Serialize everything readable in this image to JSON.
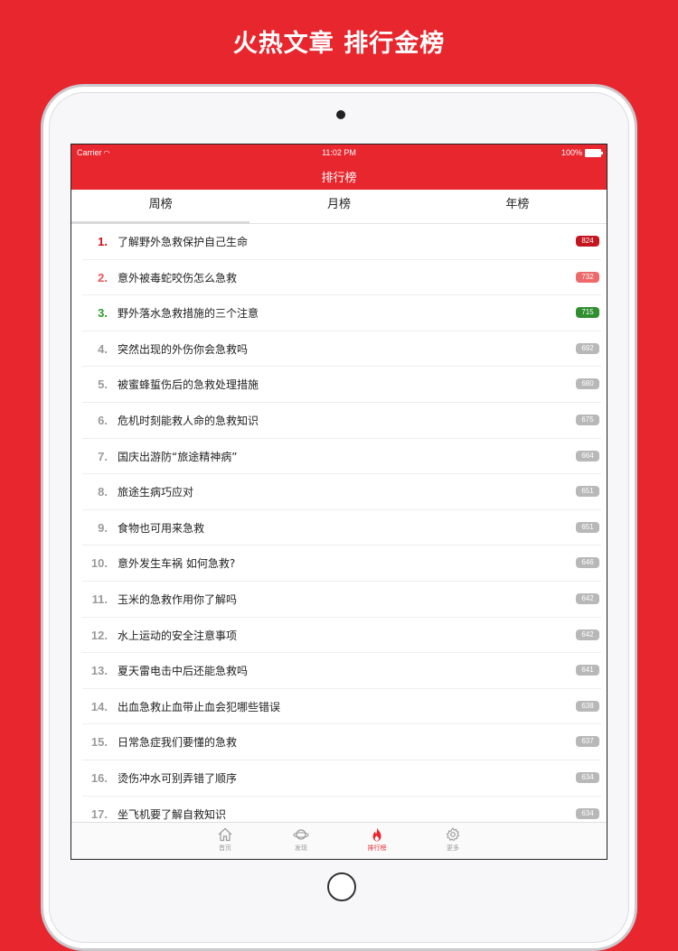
{
  "promo": {
    "title": "火热文章 排行金榜"
  },
  "status_bar": {
    "carrier": "Carrier",
    "time": "11:02 PM",
    "battery": "100%"
  },
  "nav": {
    "title": "排行榜"
  },
  "tabs": [
    {
      "label": "周榜",
      "active": true
    },
    {
      "label": "月榜",
      "active": false
    },
    {
      "label": "年榜",
      "active": false
    }
  ],
  "articles": [
    {
      "rank": "1.",
      "title": "了解野外急救保护自己生命",
      "count": "824"
    },
    {
      "rank": "2.",
      "title": "意外被毒蛇咬伤怎么急救",
      "count": "732"
    },
    {
      "rank": "3.",
      "title": "野外落水急救措施的三个注意",
      "count": "715"
    },
    {
      "rank": "4.",
      "title": "突然出现的外伤你会急救吗",
      "count": "692"
    },
    {
      "rank": "5.",
      "title": "被蜜蜂蜇伤后的急救处理措施",
      "count": "680"
    },
    {
      "rank": "6.",
      "title": "危机时刻能救人命的急救知识",
      "count": "675"
    },
    {
      "rank": "7.",
      "title": "国庆出游防“旅途精神病”",
      "count": "664"
    },
    {
      "rank": "8.",
      "title": "旅途生病巧应对",
      "count": "651"
    },
    {
      "rank": "9.",
      "title": "食物也可用来急救",
      "count": "651"
    },
    {
      "rank": "10.",
      "title": "意外发生车祸 如何急救?",
      "count": "646"
    },
    {
      "rank": "11.",
      "title": "玉米的急救作用你了解吗",
      "count": "642"
    },
    {
      "rank": "12.",
      "title": "水上运动的安全注意事项",
      "count": "642"
    },
    {
      "rank": "13.",
      "title": "夏天雷电击中后还能急救吗",
      "count": "641"
    },
    {
      "rank": "14.",
      "title": "出血急救止血带止血会犯哪些错误",
      "count": "638"
    },
    {
      "rank": "15.",
      "title": "日常急症我们要懂的急救",
      "count": "637"
    },
    {
      "rank": "16.",
      "title": "烫伤冲水可别弄错了顺序",
      "count": "634"
    },
    {
      "rank": "17.",
      "title": "坐飞机要了解自救知识",
      "count": "634"
    }
  ],
  "tabbar": [
    {
      "label": "首页",
      "icon": "home-icon",
      "active": false
    },
    {
      "label": "发现",
      "icon": "planet-icon",
      "active": false
    },
    {
      "label": "排行榜",
      "icon": "flame-icon",
      "active": true
    },
    {
      "label": "更多",
      "icon": "gear-icon",
      "active": false
    }
  ],
  "colors": {
    "accent": "#e8262e",
    "rank1": "#d0101b",
    "rank2": "#e8545a",
    "rank3": "#2e9a2e"
  }
}
